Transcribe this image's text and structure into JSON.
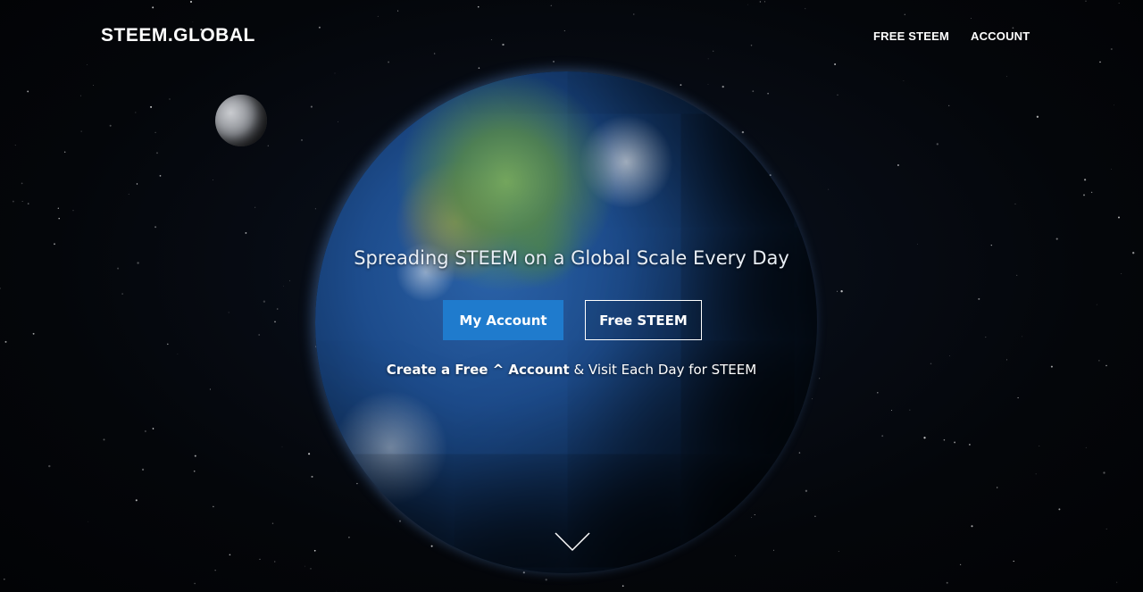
{
  "header": {
    "logo": "STEEM.GLOBAL",
    "nav": [
      {
        "label": "FREE STEEM"
      },
      {
        "label": "ACCOUNT"
      }
    ]
  },
  "hero": {
    "tagline": "Spreading STEEM on a Global Scale Every Day",
    "primary_button": "My Account",
    "secondary_button": "Free STEEM",
    "subline_bold": "Create a Free ^ Account",
    "subline_rest": " & Visit Each Day for STEEM",
    "scroll_icon": "chevron-down-icon"
  },
  "colors": {
    "accent": "#1f7bcd",
    "background": "#05070b",
    "text": "#ffffff"
  }
}
